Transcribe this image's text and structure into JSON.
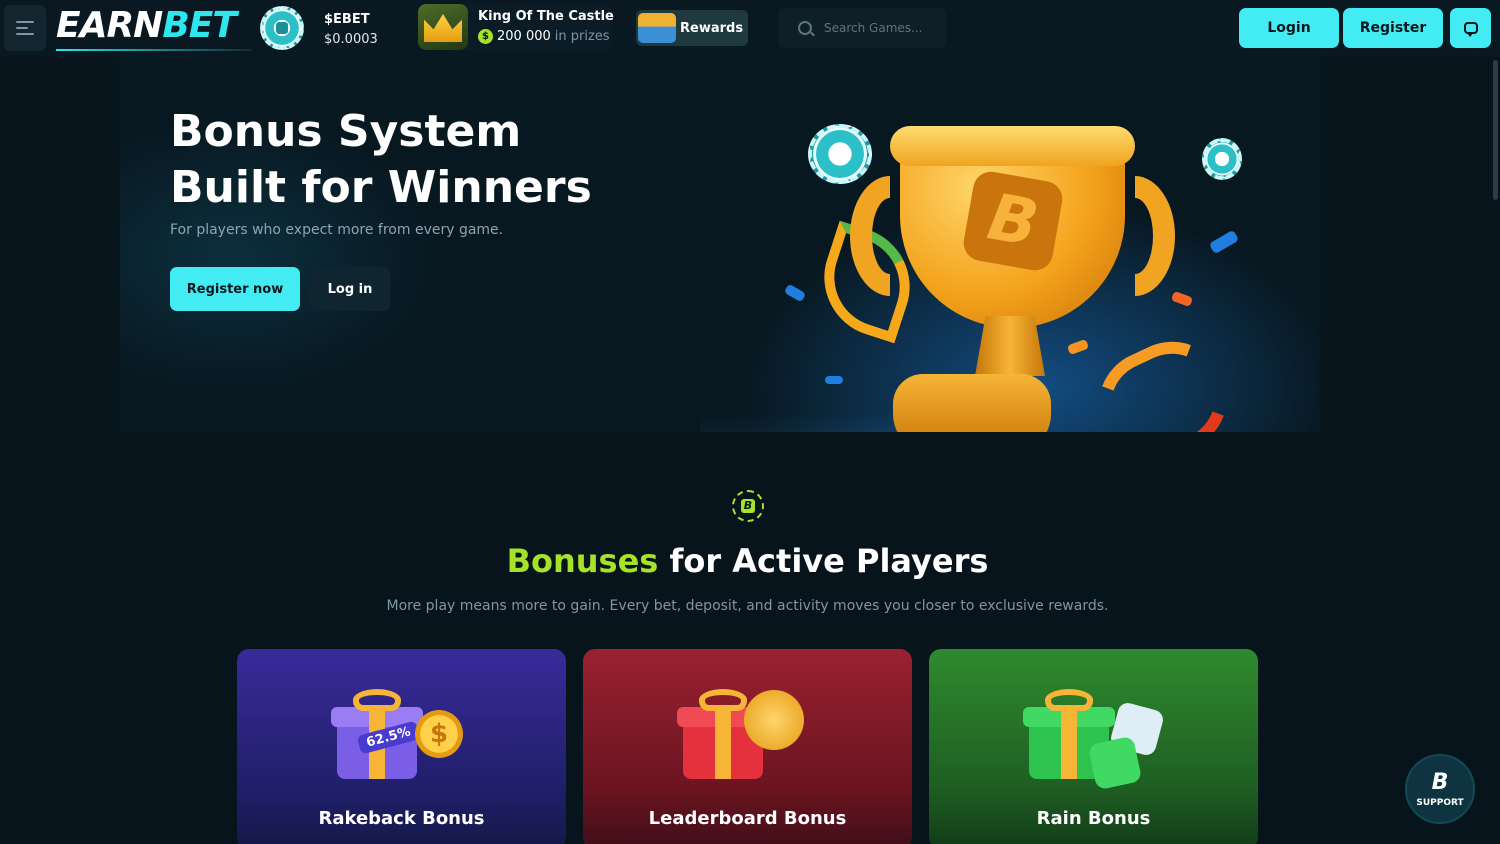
{
  "header": {
    "logo": {
      "part1": "EARN",
      "part2": "BET"
    },
    "token": {
      "name": "$EBET",
      "price": "$0.0003"
    },
    "promo": {
      "title": "King Of The Castle",
      "amount": "200 000",
      "suffix": "in prizes",
      "coin_symbol": "$"
    },
    "rewards_label": "Rewards",
    "search": {
      "placeholder": "Search Games..."
    },
    "login_label": "Login",
    "register_label": "Register"
  },
  "hero": {
    "title_line1": "Bonus System",
    "title_line2": "Built for Winners",
    "subtitle": "For players who expect more from every game.",
    "register_now_label": "Register now",
    "login_label": "Log in",
    "emblem_letter": "B"
  },
  "bonuses": {
    "title_accent": "Bonuses",
    "title_rest": "for Active Players",
    "subtitle": "More play means more to gain. Every bet, deposit, and activity moves you closer to exclusive rewards.",
    "cards": [
      {
        "title": "Rakeback Bonus",
        "badge": "62.5%",
        "coin_symbol": "$"
      },
      {
        "title": "Leaderboard Bonus"
      },
      {
        "title": "Rain Bonus"
      }
    ]
  },
  "support": {
    "icon_letter": "B",
    "label": "SUPPORT"
  },
  "colors": {
    "accent_cyan": "#43ecf3",
    "accent_green": "#a4e327",
    "background": "#07141c"
  },
  "icons": [
    "menu-icon",
    "ebet-chip-icon",
    "crown-icon",
    "coin-icon",
    "chest-icon",
    "search-icon",
    "chat-icon",
    "trophy-icon",
    "support-icon"
  ]
}
